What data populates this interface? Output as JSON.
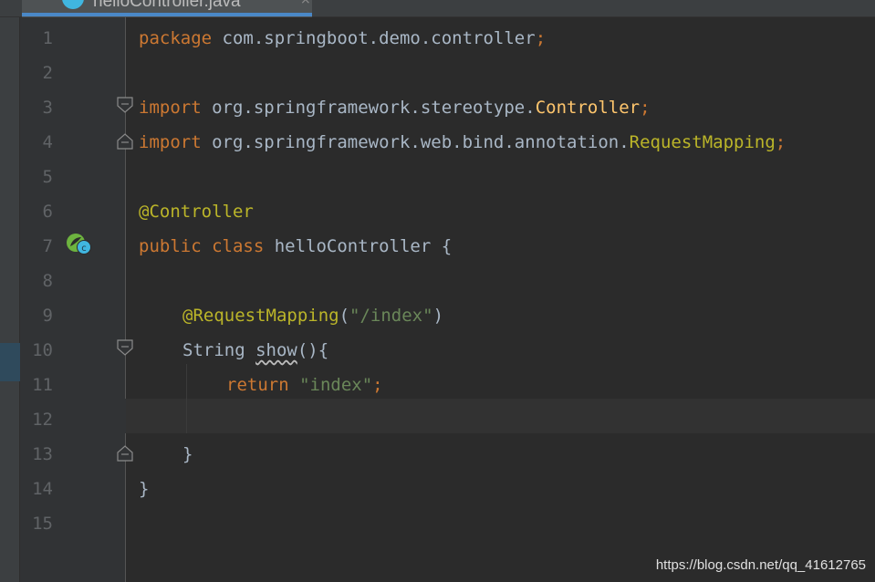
{
  "tab": {
    "title": "helloController.java",
    "close_glyph": "×",
    "icon": "java-class-icon"
  },
  "line_numbers": [
    "1",
    "2",
    "3",
    "4",
    "5",
    "6",
    "7",
    "8",
    "9",
    "10",
    "11",
    "12",
    "13",
    "14",
    "15"
  ],
  "code": {
    "l1_kw": "package",
    "l1_rest": " com.springboot.demo.controller",
    "l1_semi": ";",
    "l3_kw": "import",
    "l3_pkg": " org.springframework.stereotype.",
    "l3_cls": "Controller",
    "l3_semi": ";",
    "l4_kw": "import",
    "l4_pkg": " org.springframework.web.bind.annotation.",
    "l4_cls": "RequestMapping",
    "l4_semi": ";",
    "l6_ann": "@Controller",
    "l7_kw": "public class",
    "l7_rest": " helloController {",
    "l9_ann": "@RequestMapping",
    "l9_open": "(",
    "l9_str": "\"/index\"",
    "l9_close": ")",
    "l10_type": "String ",
    "l10_method": "show",
    "l10_rest": "(){",
    "l11_kw": "return",
    "l11_str": " \"index\"",
    "l11_semi": ";",
    "l13_brace": "}",
    "l14_brace": "}"
  },
  "gutter": {
    "bean_icon": "spring-bean-icon",
    "fold_icon": "fold-icon"
  },
  "colors": {
    "keyword": "#cc7832",
    "annotation": "#bbb529",
    "string": "#6a8759",
    "class_ref": "#ffc66d",
    "text": "#a9b7c6",
    "background": "#2b2b2b"
  },
  "watermark": "https://blog.csdn.net/qq_41612765"
}
